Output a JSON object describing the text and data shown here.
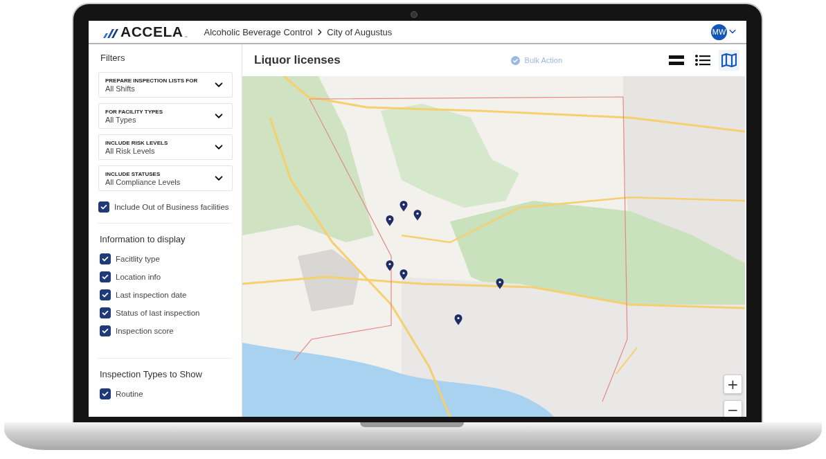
{
  "header": {
    "logo": "ACCELA",
    "logo_mark": "™",
    "breadcrumb": [
      "Alcoholic Beverage Control",
      "City of Augustus"
    ],
    "user": {
      "initials": "MW"
    }
  },
  "sidebar": {
    "title": "Filters",
    "filters": [
      {
        "label": "PREPARE INSPECTION LISTS FOR",
        "value": "All Shifts"
      },
      {
        "label": "FOR FACILITY TYPES",
        "value": "All Types"
      },
      {
        "label": "INCLUDE RISK LEVELS",
        "value": "All Risk Levels"
      },
      {
        "label": "INCLUDE STATUSES",
        "value": "All Compliance Levels"
      }
    ],
    "include_out_of_business": {
      "label": "Include Out of Business facilities",
      "checked": true
    },
    "sections": [
      {
        "title": "Information to display",
        "options": [
          {
            "label": "Facitlity type",
            "checked": true
          },
          {
            "label": "Location info",
            "checked": true
          },
          {
            "label": "Last inspection date",
            "checked": true
          },
          {
            "label": "Status of last inspection",
            "checked": true
          },
          {
            "label": "Inspection score",
            "checked": true
          }
        ]
      },
      {
        "title": "Inspection Types to Show",
        "options": [
          {
            "label": "Routine",
            "checked": true
          }
        ]
      }
    ]
  },
  "main": {
    "title": "Liquor licenses",
    "bulk_action": {
      "label": "Bulk Action",
      "disabled": true
    },
    "views": [
      {
        "kind": "cards",
        "selected": false
      },
      {
        "kind": "list",
        "selected": false
      },
      {
        "kind": "map",
        "selected": true
      }
    ],
    "map": {
      "kind": "picture",
      "zoom_buttons": [
        "+",
        "−"
      ]
    }
  }
}
